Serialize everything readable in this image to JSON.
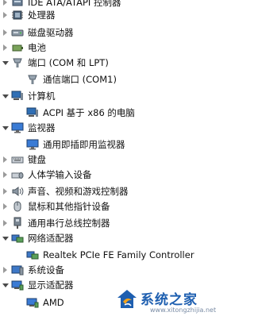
{
  "device_tree": {
    "items": [
      {
        "label": "IDE ATA/ATAPI 控制器",
        "icon": "ide-controller-icon",
        "state": "collapsed"
      },
      {
        "label": "处理器",
        "icon": "processor-icon",
        "state": "collapsed"
      },
      {
        "label": "磁盘驱动器",
        "icon": "disk-drive-icon",
        "state": "collapsed"
      },
      {
        "label": "电池",
        "icon": "battery-icon",
        "state": "collapsed"
      },
      {
        "label": "端口 (COM 和 LPT)",
        "icon": "port-icon",
        "state": "expanded"
      },
      {
        "label": "通信端口 (COM1)",
        "icon": "port-icon",
        "state": "leaf"
      },
      {
        "label": "计算机",
        "icon": "computer-icon",
        "state": "expanded"
      },
      {
        "label": "ACPI 基于 x86 的电脑",
        "icon": "computer-icon",
        "state": "leaf"
      },
      {
        "label": "监视器",
        "icon": "monitor-icon",
        "state": "expanded"
      },
      {
        "label": "通用即插即用监视器",
        "icon": "monitor-icon",
        "state": "leaf"
      },
      {
        "label": "键盘",
        "icon": "keyboard-icon",
        "state": "collapsed"
      },
      {
        "label": "人体学输入设备",
        "icon": "hid-icon",
        "state": "collapsed"
      },
      {
        "label": "声音、视频和游戏控制器",
        "icon": "sound-icon",
        "state": "collapsed"
      },
      {
        "label": "鼠标和其他指针设备",
        "icon": "mouse-icon",
        "state": "collapsed"
      },
      {
        "label": "通用串行总线控制器",
        "icon": "usb-icon",
        "state": "collapsed"
      },
      {
        "label": "网络适配器",
        "icon": "network-icon",
        "state": "expanded"
      },
      {
        "label": "Realtek PCIe FE Family Controller",
        "icon": "network-icon",
        "state": "leaf"
      },
      {
        "label": "系统设备",
        "icon": "system-icon",
        "state": "collapsed"
      },
      {
        "label": "显示适配器",
        "icon": "display-adapter-icon",
        "state": "expanded"
      },
      {
        "label": "AMD",
        "icon": "display-adapter-icon",
        "state": "leaf"
      }
    ]
  },
  "watermark": {
    "text": "系统之家",
    "url": "www.xitongzhijia.net"
  }
}
